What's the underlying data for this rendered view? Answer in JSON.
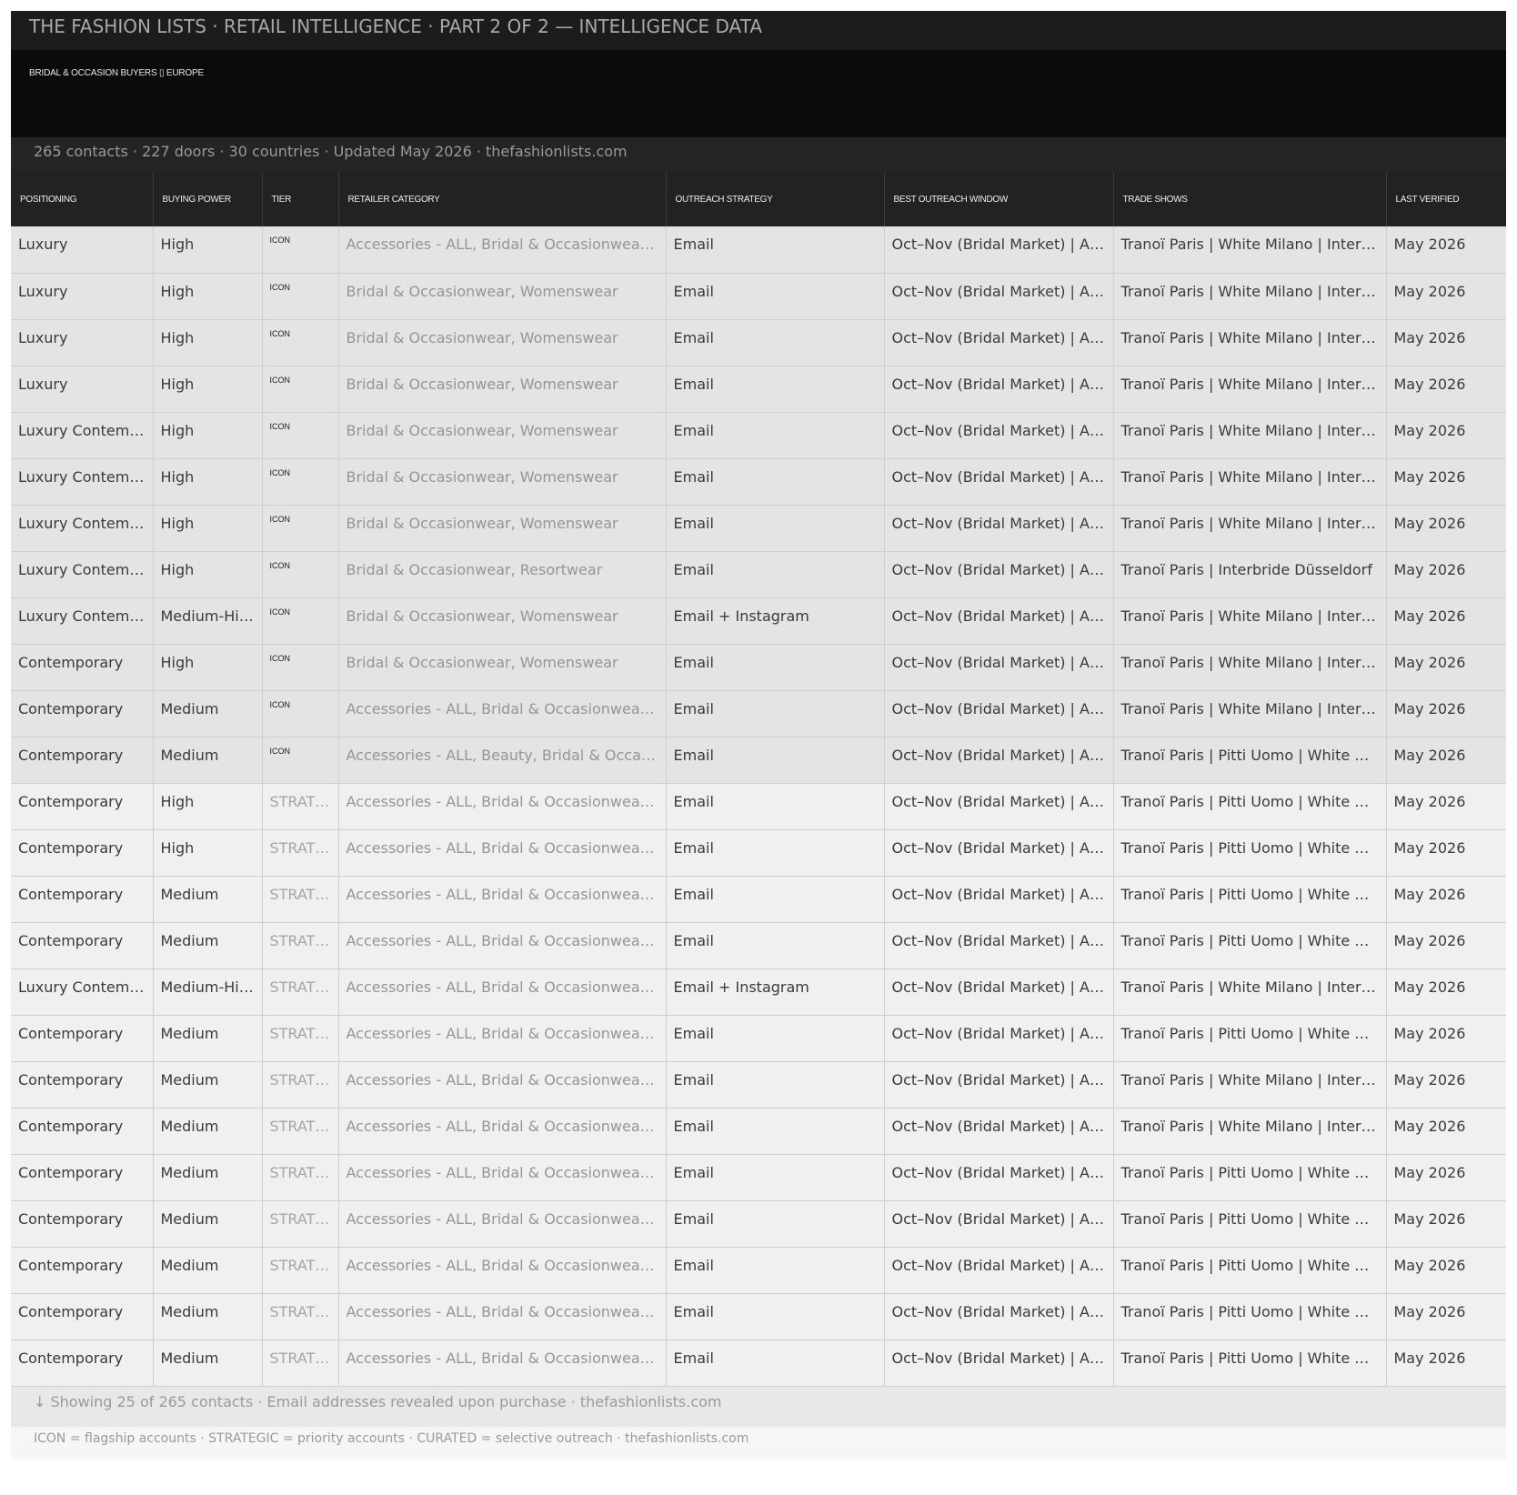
{
  "header": {
    "title": "THE FASHION LISTS  ·  RETAIL INTELLIGENCE  ·  PART 2 OF 2 — INTELLIGENCE DATA",
    "subtitle": "BRIDAL & OCCASION BUYERS ▯ EUROPE",
    "stats": "265 contacts  ·  227 doors  ·  30 countries  ·  Updated May 2026  ·  thefashionlists.com"
  },
  "table": {
    "columns": [
      "POSITIONING",
      "BUYING POWER",
      "TIER",
      "RETAILER CATEGORY",
      "OUTREACH STRATEGY",
      "BEST OUTREACH WINDOW",
      "TRADE SHOWS",
      "LAST VERIFIED"
    ],
    "rows": [
      {
        "type": "icon",
        "cells": [
          "Luxury",
          "High",
          "ICON",
          "Accessories - ALL, Bridal & Occasionwear, Womenswear",
          "Email",
          "Oct–Nov (Bridal Market) | Apr–May",
          "Tranoï Paris | White Milano | Interbride Düsseldorf",
          "May 2026"
        ]
      },
      {
        "type": "icon",
        "cells": [
          "Luxury",
          "High",
          "ICON",
          "Bridal & Occasionwear, Womenswear",
          "Email",
          "Oct–Nov (Bridal Market) | Apr–May",
          "Tranoï Paris | White Milano | Interbride Düsseldorf",
          "May 2026"
        ]
      },
      {
        "type": "icon",
        "cells": [
          "Luxury",
          "High",
          "ICON",
          "Bridal & Occasionwear, Womenswear",
          "Email",
          "Oct–Nov (Bridal Market) | Apr–May",
          "Tranoï Paris | White Milano | Interbride Düsseldorf",
          "May 2026"
        ]
      },
      {
        "type": "icon",
        "cells": [
          "Luxury",
          "High",
          "ICON",
          "Bridal & Occasionwear, Womenswear",
          "Email",
          "Oct–Nov (Bridal Market) | Apr–May",
          "Tranoï Paris | White Milano | Interbride Düsseldorf",
          "May 2026"
        ]
      },
      {
        "type": "icon",
        "cells": [
          "Luxury Contemporary",
          "High",
          "ICON",
          "Bridal & Occasionwear, Womenswear",
          "Email",
          "Oct–Nov (Bridal Market) | Apr–May",
          "Tranoï Paris | White Milano | Interbride Düsseldorf",
          "May 2026"
        ]
      },
      {
        "type": "icon",
        "cells": [
          "Luxury Contemporary",
          "High",
          "ICON",
          "Bridal & Occasionwear, Womenswear",
          "Email",
          "Oct–Nov (Bridal Market) | Apr–May",
          "Tranoï Paris | White Milano | Interbride Düsseldorf",
          "May 2026"
        ]
      },
      {
        "type": "icon",
        "cells": [
          "Luxury Contemporary",
          "High",
          "ICON",
          "Bridal & Occasionwear, Womenswear",
          "Email",
          "Oct–Nov (Bridal Market) | Apr–May",
          "Tranoï Paris | White Milano | Interbride Düsseldorf",
          "May 2026"
        ]
      },
      {
        "type": "icon",
        "cells": [
          "Luxury Contemporary",
          "High",
          "ICON",
          "Bridal & Occasionwear, Resortwear",
          "Email",
          "Oct–Nov (Bridal Market) | Apr–May",
          "Tranoï Paris | Interbride Düsseldorf",
          "May 2026"
        ]
      },
      {
        "type": "icon",
        "cells": [
          "Luxury Contemporary",
          "Medium-High",
          "ICON",
          "Bridal & Occasionwear, Womenswear",
          "Email + Instagram",
          "Oct–Nov (Bridal Market) | Apr–May",
          "Tranoï Paris | White Milano | Interbride Düsseldorf",
          "May 2026"
        ]
      },
      {
        "type": "icon",
        "cells": [
          "Contemporary",
          "High",
          "ICON",
          "Bridal & Occasionwear, Womenswear",
          "Email",
          "Oct–Nov (Bridal Market) | Apr–May",
          "Tranoï Paris | White Milano | Interbride Düsseldorf",
          "May 2026"
        ]
      },
      {
        "type": "icon",
        "cells": [
          "Contemporary",
          "Medium",
          "ICON",
          "Accessories - ALL, Bridal & Occasionwear, Womenswear",
          "Email",
          "Oct–Nov (Bridal Market) | Apr–May",
          "Tranoï Paris | White Milano | Interbride Düsseldorf",
          "May 2026"
        ]
      },
      {
        "type": "icon",
        "cells": [
          "Contemporary",
          "Medium",
          "ICON",
          "Accessories - ALL, Beauty, Bridal & Occasionwear",
          "Email",
          "Oct–Nov (Bridal Market) | Apr–May",
          "Tranoï Paris | Pitti Uomo | White Milano",
          "May 2026"
        ]
      },
      {
        "type": "strat",
        "cells": [
          "Contemporary",
          "High",
          "STRATEGIC",
          "Accessories - ALL, Bridal & Occasionwear, Womenswear",
          "Email",
          "Oct–Nov (Bridal Market) | Apr–May",
          "Tranoï Paris | Pitti Uomo | White Milano",
          "May 2026"
        ]
      },
      {
        "type": "strat",
        "cells": [
          "Contemporary",
          "High",
          "STRATEGIC",
          "Accessories - ALL, Bridal & Occasionwear, Womenswear",
          "Email",
          "Oct–Nov (Bridal Market) | Apr–May",
          "Tranoï Paris | Pitti Uomo | White Milano",
          "May 2026"
        ]
      },
      {
        "type": "strat",
        "cells": [
          "Contemporary",
          "Medium",
          "STRATEGIC",
          "Accessories - ALL, Bridal & Occasionwear, Womenswear",
          "Email",
          "Oct–Nov (Bridal Market) | Apr–May",
          "Tranoï Paris | Pitti Uomo | White Milano",
          "May 2026"
        ]
      },
      {
        "type": "strat",
        "cells": [
          "Contemporary",
          "Medium",
          "STRATEGIC",
          "Accessories - ALL, Bridal & Occasionwear, Womenswear",
          "Email",
          "Oct–Nov (Bridal Market) | Apr–May",
          "Tranoï Paris | Pitti Uomo | White Milano",
          "May 2026"
        ]
      },
      {
        "type": "strat",
        "cells": [
          "Luxury Contemporary",
          "Medium-High",
          "STRATEGIC",
          "Accessories - ALL, Bridal & Occasionwear, Womenswear",
          "Email + Instagram",
          "Oct–Nov (Bridal Market) | Apr–May",
          "Tranoï Paris | White Milano | Interbride Düsseldorf",
          "May 2026"
        ]
      },
      {
        "type": "strat",
        "cells": [
          "Contemporary",
          "Medium",
          "STRATEGIC",
          "Accessories - ALL, Bridal & Occasionwear, Womenswear",
          "Email",
          "Oct–Nov (Bridal Market) | Apr–May",
          "Tranoï Paris | Pitti Uomo | White Milano",
          "May 2026"
        ]
      },
      {
        "type": "strat",
        "cells": [
          "Contemporary",
          "Medium",
          "STRATEGIC",
          "Accessories - ALL, Bridal & Occasionwear, Womenswear",
          "Email",
          "Oct–Nov (Bridal Market) | Apr–May",
          "Tranoï Paris | White Milano | Interbride Düsseldorf",
          "May 2026"
        ]
      },
      {
        "type": "strat",
        "cells": [
          "Contemporary",
          "Medium",
          "STRATEGIC",
          "Accessories - ALL, Bridal & Occasionwear, Womenswear",
          "Email",
          "Oct–Nov (Bridal Market) | Apr–May",
          "Tranoï Paris | White Milano | Interbride Düsseldorf",
          "May 2026"
        ]
      },
      {
        "type": "strat",
        "cells": [
          "Contemporary",
          "Medium",
          "STRATEGIC",
          "Accessories - ALL, Bridal & Occasionwear, Womenswear",
          "Email",
          "Oct–Nov (Bridal Market) | Apr–May",
          "Tranoï Paris | Pitti Uomo | White Milano",
          "May 2026"
        ]
      },
      {
        "type": "strat",
        "cells": [
          "Contemporary",
          "Medium",
          "STRATEGIC",
          "Accessories - ALL, Bridal & Occasionwear, Womenswear",
          "Email",
          "Oct–Nov (Bridal Market) | Apr–May",
          "Tranoï Paris | Pitti Uomo | White Milano",
          "May 2026"
        ]
      },
      {
        "type": "strat",
        "cells": [
          "Contemporary",
          "Medium",
          "STRATEGIC",
          "Accessories - ALL, Bridal & Occasionwear, Womenswear",
          "Email",
          "Oct–Nov (Bridal Market) | Apr–May",
          "Tranoï Paris | Pitti Uomo | White Milano",
          "May 2026"
        ]
      },
      {
        "type": "strat",
        "cells": [
          "Contemporary",
          "Medium",
          "STRATEGIC",
          "Accessories - ALL, Bridal & Occasionwear, Womenswear",
          "Email",
          "Oct–Nov (Bridal Market) | Apr–May",
          "Tranoï Paris | Pitti Uomo | White Milano",
          "May 2026"
        ]
      },
      {
        "type": "strat",
        "cells": [
          "Contemporary",
          "Medium",
          "STRATEGIC",
          "Accessories - ALL, Bridal & Occasionwear, Womenswear",
          "Email",
          "Oct–Nov (Bridal Market) | Apr–May",
          "Tranoï Paris | Pitti Uomo | White Milano",
          "May 2026"
        ]
      }
    ]
  },
  "footer": {
    "showing": "↓  Showing 25 of 265 contacts  ·  Email addresses revealed upon purchase  ·  thefashionlists.com",
    "legend": "ICON = flagship accounts  ·  STRATEGIC = priority accounts  ·  CURATED = selective outreach  ·  thefashionlists.com"
  }
}
